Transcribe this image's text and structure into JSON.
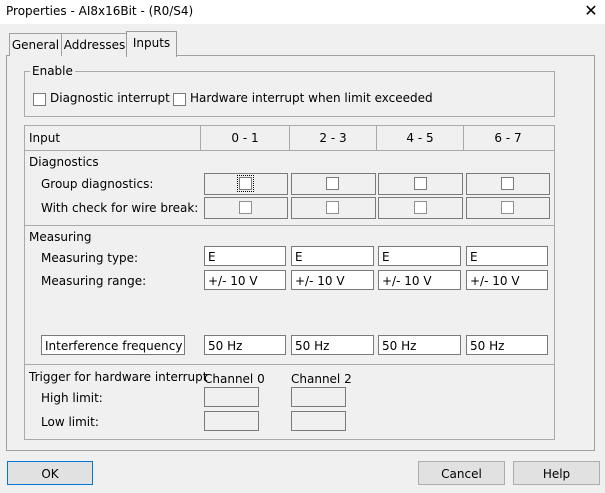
{
  "window": {
    "title": "Properties - AI8x16Bit - (R0/S4)",
    "close_glyph": "✕"
  },
  "tabs": [
    {
      "label": "General"
    },
    {
      "label": "Addresses"
    },
    {
      "label": "Inputs",
      "active": true
    }
  ],
  "enable": {
    "legend": "Enable",
    "diagnostic_interrupt": {
      "label": "Diagnostic interrupt",
      "checked": false
    },
    "hardware_interrupt": {
      "label": "Hardware interrupt when limit exceeded",
      "checked": false
    }
  },
  "table": {
    "input_header": "Input",
    "columns": [
      "0 - 1",
      "2 - 3",
      "4 - 5",
      "6 - 7"
    ]
  },
  "diagnostics": {
    "title": "Diagnostics",
    "group_label": "Group diagnostics:",
    "wire_break_label": "With check for wire break:"
  },
  "measuring": {
    "title": "Measuring",
    "type_label": "Measuring type:",
    "range_label": "Measuring range:",
    "types": [
      "E",
      "E",
      "E",
      "E"
    ],
    "ranges": [
      "+/- 10 V",
      "+/- 10 V",
      "+/- 10 V",
      "+/- 10 V"
    ],
    "interference_label": "Interference frequency",
    "interference": [
      "50 Hz",
      "50 Hz",
      "50 Hz",
      "50 Hz"
    ]
  },
  "trigger": {
    "title": "Trigger for hardware interrupt",
    "channel_a": "Channel 0",
    "channel_b": "Channel 2",
    "high_label": "High limit:",
    "low_label": "Low limit:",
    "high_a": "",
    "high_b": "",
    "low_a": "",
    "low_b": ""
  },
  "buttons": {
    "ok": "OK",
    "cancel": "Cancel",
    "help": "Help"
  }
}
